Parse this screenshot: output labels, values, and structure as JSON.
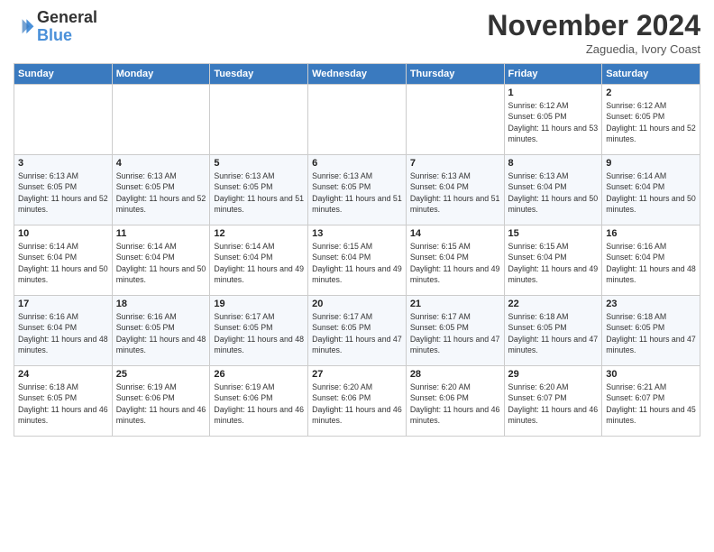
{
  "logo": {
    "general": "General",
    "blue": "Blue"
  },
  "header": {
    "month_title": "November 2024",
    "location": "Zaguedia, Ivory Coast"
  },
  "days_of_week": [
    "Sunday",
    "Monday",
    "Tuesday",
    "Wednesday",
    "Thursday",
    "Friday",
    "Saturday"
  ],
  "weeks": [
    [
      {
        "day": "",
        "info": ""
      },
      {
        "day": "",
        "info": ""
      },
      {
        "day": "",
        "info": ""
      },
      {
        "day": "",
        "info": ""
      },
      {
        "day": "",
        "info": ""
      },
      {
        "day": "1",
        "info": "Sunrise: 6:12 AM\nSunset: 6:05 PM\nDaylight: 11 hours and 53 minutes."
      },
      {
        "day": "2",
        "info": "Sunrise: 6:12 AM\nSunset: 6:05 PM\nDaylight: 11 hours and 52 minutes."
      }
    ],
    [
      {
        "day": "3",
        "info": "Sunrise: 6:13 AM\nSunset: 6:05 PM\nDaylight: 11 hours and 52 minutes."
      },
      {
        "day": "4",
        "info": "Sunrise: 6:13 AM\nSunset: 6:05 PM\nDaylight: 11 hours and 52 minutes."
      },
      {
        "day": "5",
        "info": "Sunrise: 6:13 AM\nSunset: 6:05 PM\nDaylight: 11 hours and 51 minutes."
      },
      {
        "day": "6",
        "info": "Sunrise: 6:13 AM\nSunset: 6:05 PM\nDaylight: 11 hours and 51 minutes."
      },
      {
        "day": "7",
        "info": "Sunrise: 6:13 AM\nSunset: 6:04 PM\nDaylight: 11 hours and 51 minutes."
      },
      {
        "day": "8",
        "info": "Sunrise: 6:13 AM\nSunset: 6:04 PM\nDaylight: 11 hours and 50 minutes."
      },
      {
        "day": "9",
        "info": "Sunrise: 6:14 AM\nSunset: 6:04 PM\nDaylight: 11 hours and 50 minutes."
      }
    ],
    [
      {
        "day": "10",
        "info": "Sunrise: 6:14 AM\nSunset: 6:04 PM\nDaylight: 11 hours and 50 minutes."
      },
      {
        "day": "11",
        "info": "Sunrise: 6:14 AM\nSunset: 6:04 PM\nDaylight: 11 hours and 50 minutes."
      },
      {
        "day": "12",
        "info": "Sunrise: 6:14 AM\nSunset: 6:04 PM\nDaylight: 11 hours and 49 minutes."
      },
      {
        "day": "13",
        "info": "Sunrise: 6:15 AM\nSunset: 6:04 PM\nDaylight: 11 hours and 49 minutes."
      },
      {
        "day": "14",
        "info": "Sunrise: 6:15 AM\nSunset: 6:04 PM\nDaylight: 11 hours and 49 minutes."
      },
      {
        "day": "15",
        "info": "Sunrise: 6:15 AM\nSunset: 6:04 PM\nDaylight: 11 hours and 49 minutes."
      },
      {
        "day": "16",
        "info": "Sunrise: 6:16 AM\nSunset: 6:04 PM\nDaylight: 11 hours and 48 minutes."
      }
    ],
    [
      {
        "day": "17",
        "info": "Sunrise: 6:16 AM\nSunset: 6:04 PM\nDaylight: 11 hours and 48 minutes."
      },
      {
        "day": "18",
        "info": "Sunrise: 6:16 AM\nSunset: 6:05 PM\nDaylight: 11 hours and 48 minutes."
      },
      {
        "day": "19",
        "info": "Sunrise: 6:17 AM\nSunset: 6:05 PM\nDaylight: 11 hours and 48 minutes."
      },
      {
        "day": "20",
        "info": "Sunrise: 6:17 AM\nSunset: 6:05 PM\nDaylight: 11 hours and 47 minutes."
      },
      {
        "day": "21",
        "info": "Sunrise: 6:17 AM\nSunset: 6:05 PM\nDaylight: 11 hours and 47 minutes."
      },
      {
        "day": "22",
        "info": "Sunrise: 6:18 AM\nSunset: 6:05 PM\nDaylight: 11 hours and 47 minutes."
      },
      {
        "day": "23",
        "info": "Sunrise: 6:18 AM\nSunset: 6:05 PM\nDaylight: 11 hours and 47 minutes."
      }
    ],
    [
      {
        "day": "24",
        "info": "Sunrise: 6:18 AM\nSunset: 6:05 PM\nDaylight: 11 hours and 46 minutes."
      },
      {
        "day": "25",
        "info": "Sunrise: 6:19 AM\nSunset: 6:06 PM\nDaylight: 11 hours and 46 minutes."
      },
      {
        "day": "26",
        "info": "Sunrise: 6:19 AM\nSunset: 6:06 PM\nDaylight: 11 hours and 46 minutes."
      },
      {
        "day": "27",
        "info": "Sunrise: 6:20 AM\nSunset: 6:06 PM\nDaylight: 11 hours and 46 minutes."
      },
      {
        "day": "28",
        "info": "Sunrise: 6:20 AM\nSunset: 6:06 PM\nDaylight: 11 hours and 46 minutes."
      },
      {
        "day": "29",
        "info": "Sunrise: 6:20 AM\nSunset: 6:07 PM\nDaylight: 11 hours and 46 minutes."
      },
      {
        "day": "30",
        "info": "Sunrise: 6:21 AM\nSunset: 6:07 PM\nDaylight: 11 hours and 45 minutes."
      }
    ]
  ]
}
